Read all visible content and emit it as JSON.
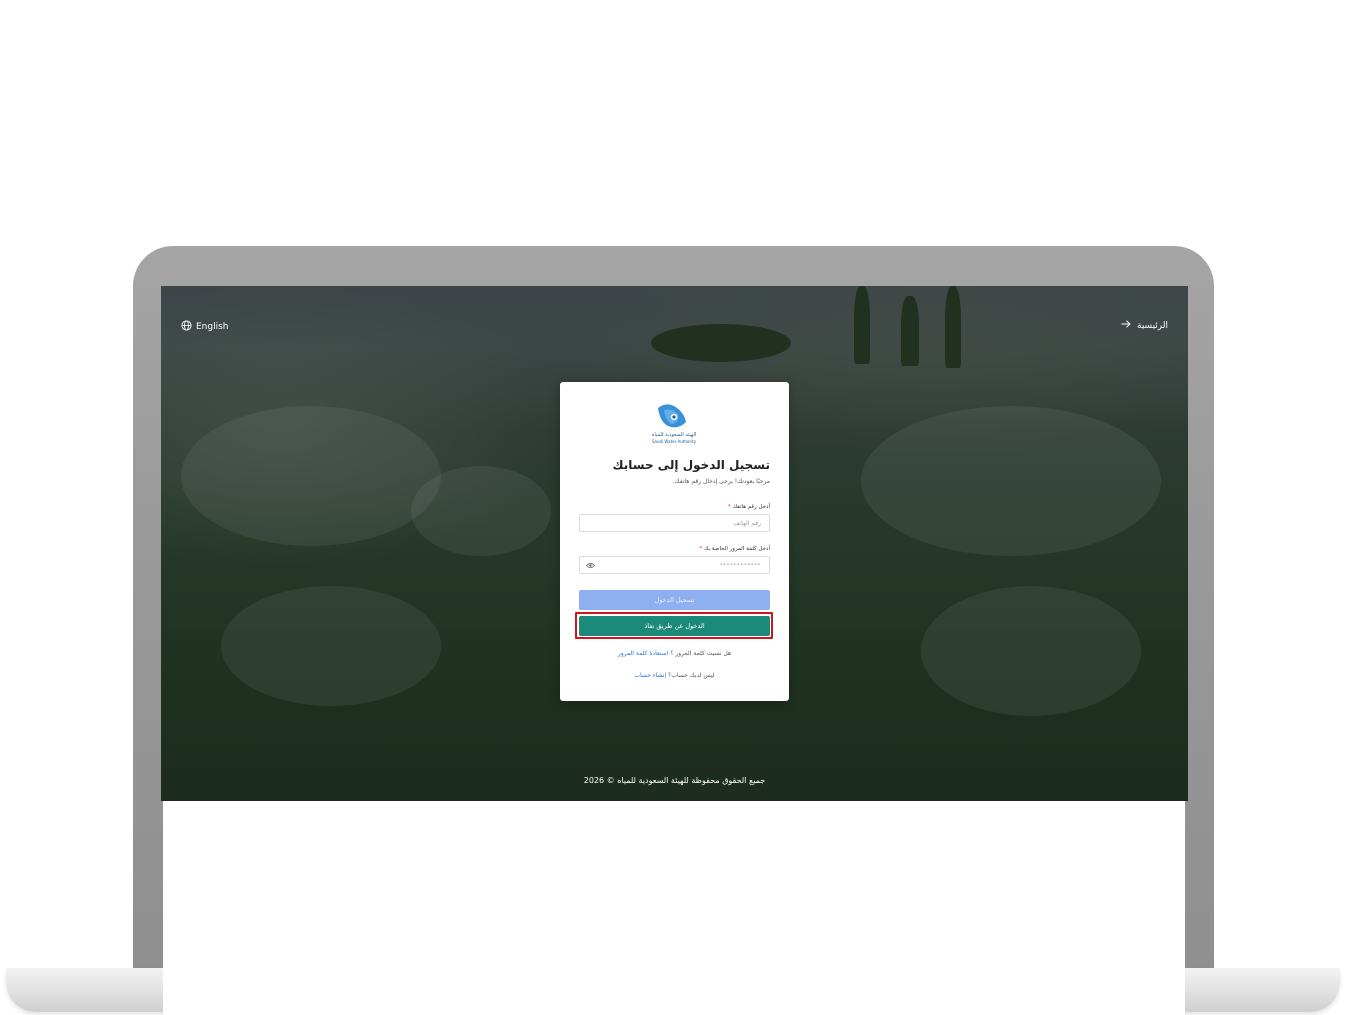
{
  "header": {
    "language_label": "English",
    "home_label": "الرئيسية"
  },
  "logo": {
    "name_ar": "الهيئة السعودية للمياه",
    "name_en": "Saudi Water Authority"
  },
  "login_card": {
    "title": "تسجيل الدخول إلى حسابك",
    "subtitle": "مرحبًا بعودتك! يرجى إدخال رقم هاتفك.",
    "phone": {
      "label": "أدخل رقم هاتفك",
      "placeholder": "رقم الهاتف",
      "value": ""
    },
    "password": {
      "label": "أدخل كلمة المرور الخاصة بك",
      "masked_value": "••••••••••••"
    },
    "required_mark": "*",
    "login_button": "تسجيل الدخول",
    "nafath_button": "الدخول عن طريق نفاذ",
    "forgot_prompt": "هل نسيت كلمة المرور ؟",
    "forgot_link": "استعادة كلمة المرور",
    "signup_prompt": "ليس لديك حساب؟",
    "signup_link": "إنشاء حساب"
  },
  "footer": {
    "copyright": "جميع الحقوق محفوظة للهيئة السعودية للمياه © 2026"
  },
  "colors": {
    "primary_teal": "#1b8a7b",
    "login_button_disabled": "#8fb0f0",
    "link_blue": "#2b72d8",
    "highlight_red": "#d0161b"
  },
  "icons": {
    "language": "globe-icon",
    "home": "arrow-right-icon",
    "password_toggle": "eye-icon"
  }
}
